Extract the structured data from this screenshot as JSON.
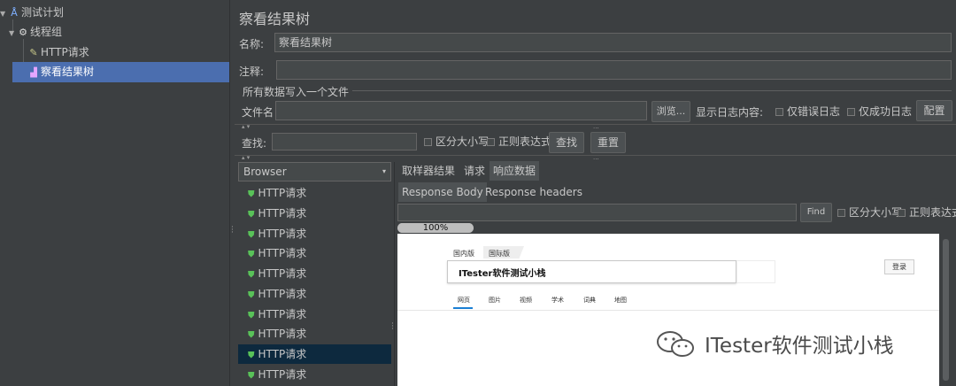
{
  "tree": {
    "items": [
      {
        "label": "测试计划"
      },
      {
        "label": "线程组"
      },
      {
        "label": "HTTP请求"
      },
      {
        "label": "察看结果树"
      }
    ]
  },
  "panel": {
    "title": "察看结果树",
    "name_label": "名称:",
    "name_value": "察看结果树",
    "comment_label": "注释:",
    "comment_value": "",
    "write_section_label": "所有数据写入一个文件",
    "filename_label": "文件名",
    "filename_value": "",
    "browse_button": "浏览...",
    "log_label": "显示日志内容:",
    "errors_only": "仅错误日志",
    "success_only": "仅成功日志",
    "config_button": "配置"
  },
  "search": {
    "label": "查找:",
    "value": "",
    "case_sensitive": "区分大小写",
    "regex": "正则表达式",
    "find_button": "查找",
    "reset_button": "重置"
  },
  "results": {
    "renderer": "Browser",
    "items": [
      {
        "label": "HTTP请求"
      },
      {
        "label": "HTTP请求"
      },
      {
        "label": "HTTP请求"
      },
      {
        "label": "HTTP请求"
      },
      {
        "label": "HTTP请求"
      },
      {
        "label": "HTTP请求"
      },
      {
        "label": "HTTP请求"
      },
      {
        "label": "HTTP请求"
      },
      {
        "label": "HTTP请求"
      },
      {
        "label": "HTTP请求"
      }
    ],
    "selected_index": 8
  },
  "detail": {
    "tabs": [
      {
        "label": "取样器结果"
      },
      {
        "label": "请求"
      },
      {
        "label": "响应数据"
      }
    ],
    "subtabs": [
      {
        "label": "Response Body"
      },
      {
        "label": "Response headers"
      }
    ],
    "find_value": "",
    "find_button": "Find",
    "case_sensitive": "区分大小写",
    "regex": "正则表达式",
    "progress": {
      "value": 100,
      "label": "100%"
    }
  },
  "webpage": {
    "tab_domestic": "国内版",
    "tab_international": "国际版",
    "search_value": "ITester软件测试小栈",
    "login_button": "登录",
    "nav": [
      "网页",
      "图片",
      "视频",
      "学术",
      "词典",
      "地图"
    ]
  },
  "watermark": {
    "text": "ITester软件测试小栈"
  },
  "colors": {
    "background": "#3c3f41",
    "selection": "#4b6eaf",
    "list_selection": "#0d293e",
    "success_icon": "#59c259"
  }
}
